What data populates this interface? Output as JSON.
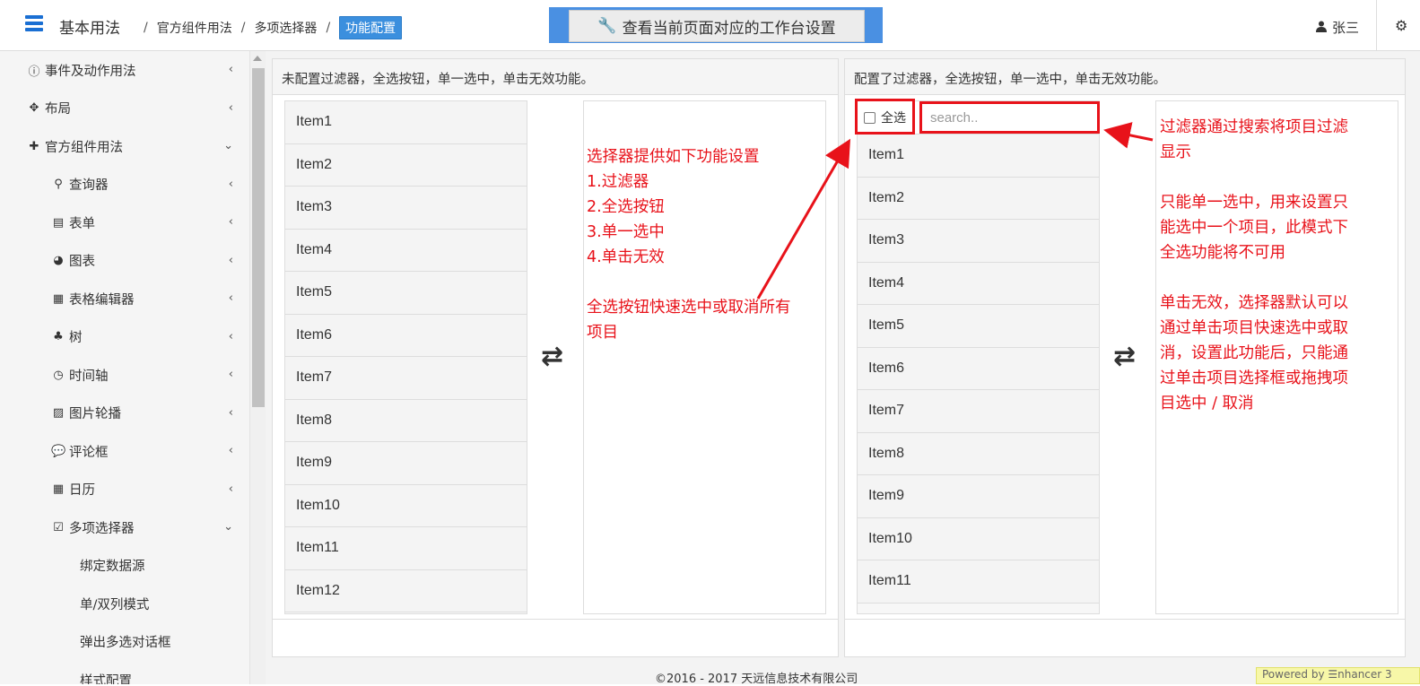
{
  "header": {
    "brand": "基本用法",
    "breadcrumb": [
      "官方组件用法",
      "多项选择器"
    ],
    "breadcrumb_sep": "/",
    "breadcrumb_active": "功能配置",
    "workbench_button": "查看当前页面对应的工作台设置",
    "user_name": "张三"
  },
  "sidebar": {
    "items": [
      {
        "label": "事件及动作用法",
        "icon": "info-icon",
        "level": 1,
        "arrow": "‹"
      },
      {
        "label": "布局",
        "icon": "move-icon",
        "level": 1,
        "arrow": "‹"
      },
      {
        "label": "官方组件用法",
        "icon": "puzzle-icon",
        "level": 1,
        "arrow": "⌄"
      },
      {
        "label": "查询器",
        "icon": "search-icon",
        "level": 2,
        "arrow": "‹"
      },
      {
        "label": "表单",
        "icon": "form-icon",
        "level": 2,
        "arrow": "‹"
      },
      {
        "label": "图表",
        "icon": "pie-chart-icon",
        "level": 2,
        "arrow": "‹"
      },
      {
        "label": "表格编辑器",
        "icon": "table-icon",
        "level": 2,
        "arrow": "‹"
      },
      {
        "label": "树",
        "icon": "sitemap-icon",
        "level": 2,
        "arrow": "‹"
      },
      {
        "label": "时间轴",
        "icon": "clock-icon",
        "level": 2,
        "arrow": "‹"
      },
      {
        "label": "图片轮播",
        "icon": "image-icon",
        "level": 2,
        "arrow": "‹"
      },
      {
        "label": "评论框",
        "icon": "comment-icon",
        "level": 2,
        "arrow": "‹"
      },
      {
        "label": "日历",
        "icon": "calendar-icon",
        "level": 2,
        "arrow": "‹"
      },
      {
        "label": "多项选择器",
        "icon": "check-square-icon",
        "level": 2,
        "arrow": "⌄"
      },
      {
        "label": "绑定数据源",
        "icon": "",
        "level": 3,
        "arrow": ""
      },
      {
        "label": "单/双列模式",
        "icon": "",
        "level": 3,
        "arrow": ""
      },
      {
        "label": "弹出多选对话框",
        "icon": "",
        "level": 3,
        "arrow": ""
      },
      {
        "label": "样式配置",
        "icon": "",
        "level": 3,
        "arrow": ""
      }
    ]
  },
  "left_panel": {
    "title": "未配置过滤器，全选按钮，单一选中，单击无效功能。",
    "items": [
      "Item1",
      "Item2",
      "Item3",
      "Item4",
      "Item5",
      "Item6",
      "Item7",
      "Item8",
      "Item9",
      "Item10",
      "Item11",
      "Item12"
    ],
    "annotation_lines": [
      "选择器提供如下功能设置",
      "1.过滤器",
      "2.全选按钮",
      "3.单一选中",
      "4.单击无效",
      "",
      "全选按钮快速选中或取消所有",
      "项目"
    ]
  },
  "right_panel": {
    "title": "配置了过滤器，全选按钮，单一选中，单击无效功能。",
    "select_all_label": "全选",
    "search_placeholder": "search..",
    "items": [
      "Item1",
      "Item2",
      "Item3",
      "Item4",
      "Item5",
      "Item6",
      "Item7",
      "Item8",
      "Item9",
      "Item10",
      "Item11"
    ],
    "annotation_lines": [
      "过滤器通过搜索将项目过滤",
      "显示",
      "",
      "只能单一选中，用来设置只",
      "能选中一个项目，此模式下",
      "全选功能将不可用",
      "",
      "单击无效，选择器默认可以",
      "通过单击项目快速选中或取",
      "消，设置此功能后，只能通",
      "过单击项目选择框或拖拽项",
      "目选中 / 取消"
    ]
  },
  "swap_glyph": "⇄",
  "footer": {
    "copyright": "©2016 - 2017 天远信息技术有限公司",
    "powered": "Powered by ☰nhancer 3"
  },
  "colors": {
    "accent": "#3b8fde",
    "annotation": "#e8121a",
    "brand_blue": "#1a6fd3"
  }
}
